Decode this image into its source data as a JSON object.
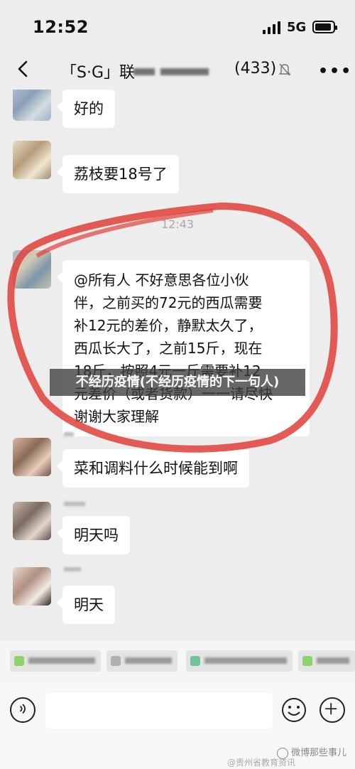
{
  "status": {
    "time": "12:52",
    "network": "5G",
    "battery_level": 0.9
  },
  "header": {
    "title": "「S·G」联",
    "count": "(433)"
  },
  "messages": [
    {
      "text": "好的"
    },
    {
      "text": "荔枝要18号了"
    },
    {
      "timestamp": "12:43"
    },
    {
      "lines": [
        "@所有人 不好意思各位小伙",
        "伴，之前买的72元的西瓜需要",
        "补12元的差价，静默太久了，",
        "西瓜长大了，之前15斤，现在",
        "18斤，按照4元一斤需要补12",
        "元差价（或者货款）一一请尽快",
        "谢谢大家理解"
      ]
    },
    {
      "text": "菜和调料什么时候能到啊"
    },
    {
      "text": "明天吗"
    },
    {
      "text": "明天"
    }
  ],
  "overlay": {
    "caption": "不经历疫情(不经历疫情的下一句人)"
  },
  "watermark": {
    "text": "微博那些事儿",
    "subtext": "@贵州省教育资讯"
  },
  "colors": {
    "background": "#ededed",
    "bubble": "#ffffff",
    "annotation": "#e0403a",
    "overlay": "#3c3c3c"
  },
  "icons": [
    "back-arrow-icon",
    "mute-bell-icon",
    "more-icon",
    "voice-icon",
    "emoji-icon",
    "plus-icon"
  ]
}
